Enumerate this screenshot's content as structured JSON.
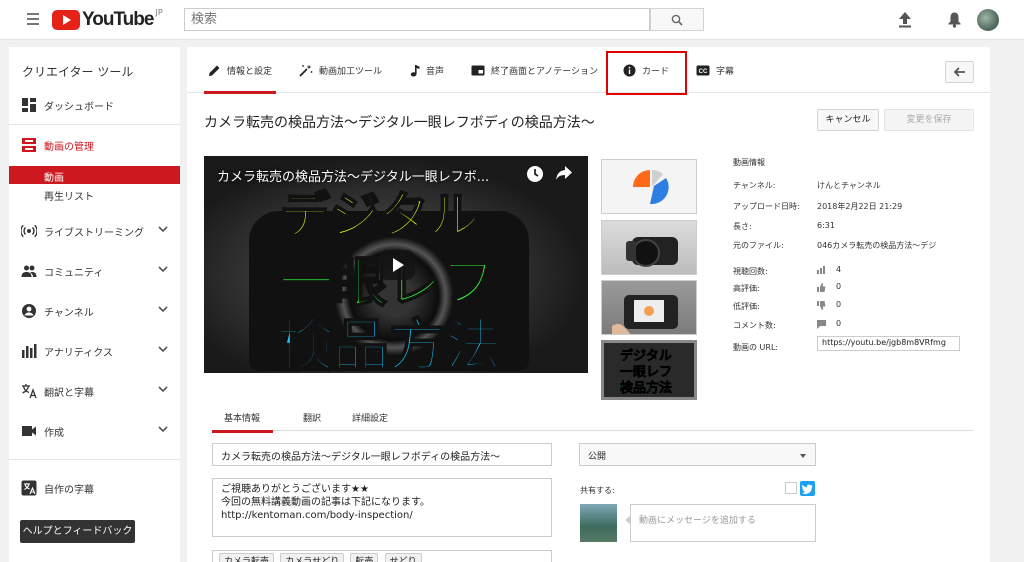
{
  "header": {
    "logo_text": "YouTube",
    "logo_region": "JP",
    "search_placeholder": "検索"
  },
  "sidebar": {
    "title": "クリエイター ツール",
    "items": {
      "dashboard": "ダッシュボード",
      "video_manager": "動画の管理",
      "videos": "動画",
      "playlists": "再生リスト",
      "live": "ライブストリーミング",
      "community": "コミュニティ",
      "channel": "チャンネル",
      "analytics": "アナリティクス",
      "translations": "翻訳と字幕",
      "create": "作成",
      "your_subtitles": "自作の字幕"
    },
    "help_button": "ヘルプとフィードバック"
  },
  "tabs": {
    "info": "情報と設定",
    "enhancements": "動画加工ツール",
    "audio": "音声",
    "end_screen": "終了画面とアノテーション",
    "cards": "カード",
    "subtitles": "字幕"
  },
  "video": {
    "title": "カメラ転売の検品方法〜デジタル一眼レフボディの検品方法〜",
    "player_title": "カメラ転売の検品方法〜デジタル一眼レフボ...",
    "thumb_line1": "デジタル",
    "thumb_line2": "一眼レフ",
    "thumb_line3": "検品方法"
  },
  "buttons": {
    "cancel": "キャンセル",
    "save": "変更を保存"
  },
  "video_info": {
    "heading": "動画情報",
    "channel_label": "チャンネル:",
    "channel_value": "けんとチャンネル",
    "upload_label": "アップロード日時:",
    "upload_value": "2018年2月22日 21:29",
    "length_label": "長さ:",
    "length_value": "6:31",
    "file_label": "元のファイル:",
    "file_value": "046カメラ転売の検品方法〜デジ",
    "views_label": "視聴回数:",
    "views_value": "4",
    "likes_label": "高評価:",
    "likes_value": "0",
    "dislikes_label": "低評価:",
    "dislikes_value": "0",
    "comments_label": "コメント数:",
    "comments_value": "0",
    "url_label": "動画の URL:",
    "url_value": "https://youtu.be/jgb8m8VRfmg"
  },
  "subtabs": {
    "basic": "基本情報",
    "translation": "翻訳",
    "advanced": "詳細設定"
  },
  "form": {
    "title_value": "カメラ転売の検品方法〜デジタル一眼レフボディの検品方法〜",
    "desc_line1": "ご視聴ありがとうございます★★",
    "desc_line2": "今回の無料講義動画の記事は下記になります。",
    "desc_line3": "http://kentoman.com/body-inspection/",
    "tags": [
      "カメラ転売",
      "カメラせどり",
      "転売",
      "せどり"
    ],
    "privacy_value": "公開",
    "share_label": "共有する:",
    "message_placeholder": "動画にメッセージを追加する"
  },
  "colors": {
    "accent": "#cc181e",
    "highlight_box": "#e00000"
  }
}
